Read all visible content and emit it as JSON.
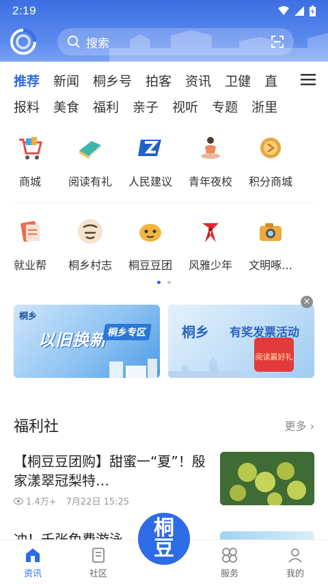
{
  "status": {
    "time": "2:19"
  },
  "search": {
    "placeholder": "搜索"
  },
  "tabs_row1": [
    "推荐",
    "新闻",
    "桐乡号",
    "拍客",
    "资讯",
    "卫健",
    "直"
  ],
  "tabs_row2": [
    "报料",
    "美食",
    "福利",
    "亲子",
    "视听",
    "专题",
    "浙里"
  ],
  "grid_row1": [
    {
      "label": "商城",
      "icon": "shopping-cart-icon"
    },
    {
      "label": "阅读有礼",
      "icon": "book-gift-icon"
    },
    {
      "label": "人民建议",
      "icon": "suggestion-z-icon"
    },
    {
      "label": "青年夜校",
      "icon": "yoga-person-icon"
    },
    {
      "label": "积分商城",
      "icon": "coin-icon"
    }
  ],
  "grid_row2": [
    {
      "label": "就业帮",
      "icon": "resume-icon"
    },
    {
      "label": "桐乡村志",
      "icon": "village-record-icon"
    },
    {
      "label": "桐豆豆团",
      "icon": "mascot-icon"
    },
    {
      "label": "风雅少年",
      "icon": "red-scarf-icon"
    },
    {
      "label": "文明啄…",
      "icon": "camera-icon"
    }
  ],
  "banners": {
    "b1": {
      "brand": "桐乡",
      "title": "以旧换新",
      "tag": "桐乡专区"
    },
    "b2": {
      "brand": "桐乡",
      "title": "有奖发票活动",
      "gift": "阅读赢好礼"
    }
  },
  "section": {
    "title": "福利社",
    "more": "更多"
  },
  "article1": {
    "title": "【桐豆豆团购】甜蜜一“夏”！殷家漾翠冠梨特…",
    "views": "1.4万+",
    "time": "7月22日  15:25"
  },
  "article2": {
    "title": "冲！千张免费游泳…"
  },
  "bottom_nav": {
    "home": "资讯",
    "community": "社区",
    "center": "桐豆",
    "service": "服务",
    "mine": "我的"
  },
  "colors": {
    "accent": "#2e6be6",
    "header": "#4a7ee8"
  }
}
